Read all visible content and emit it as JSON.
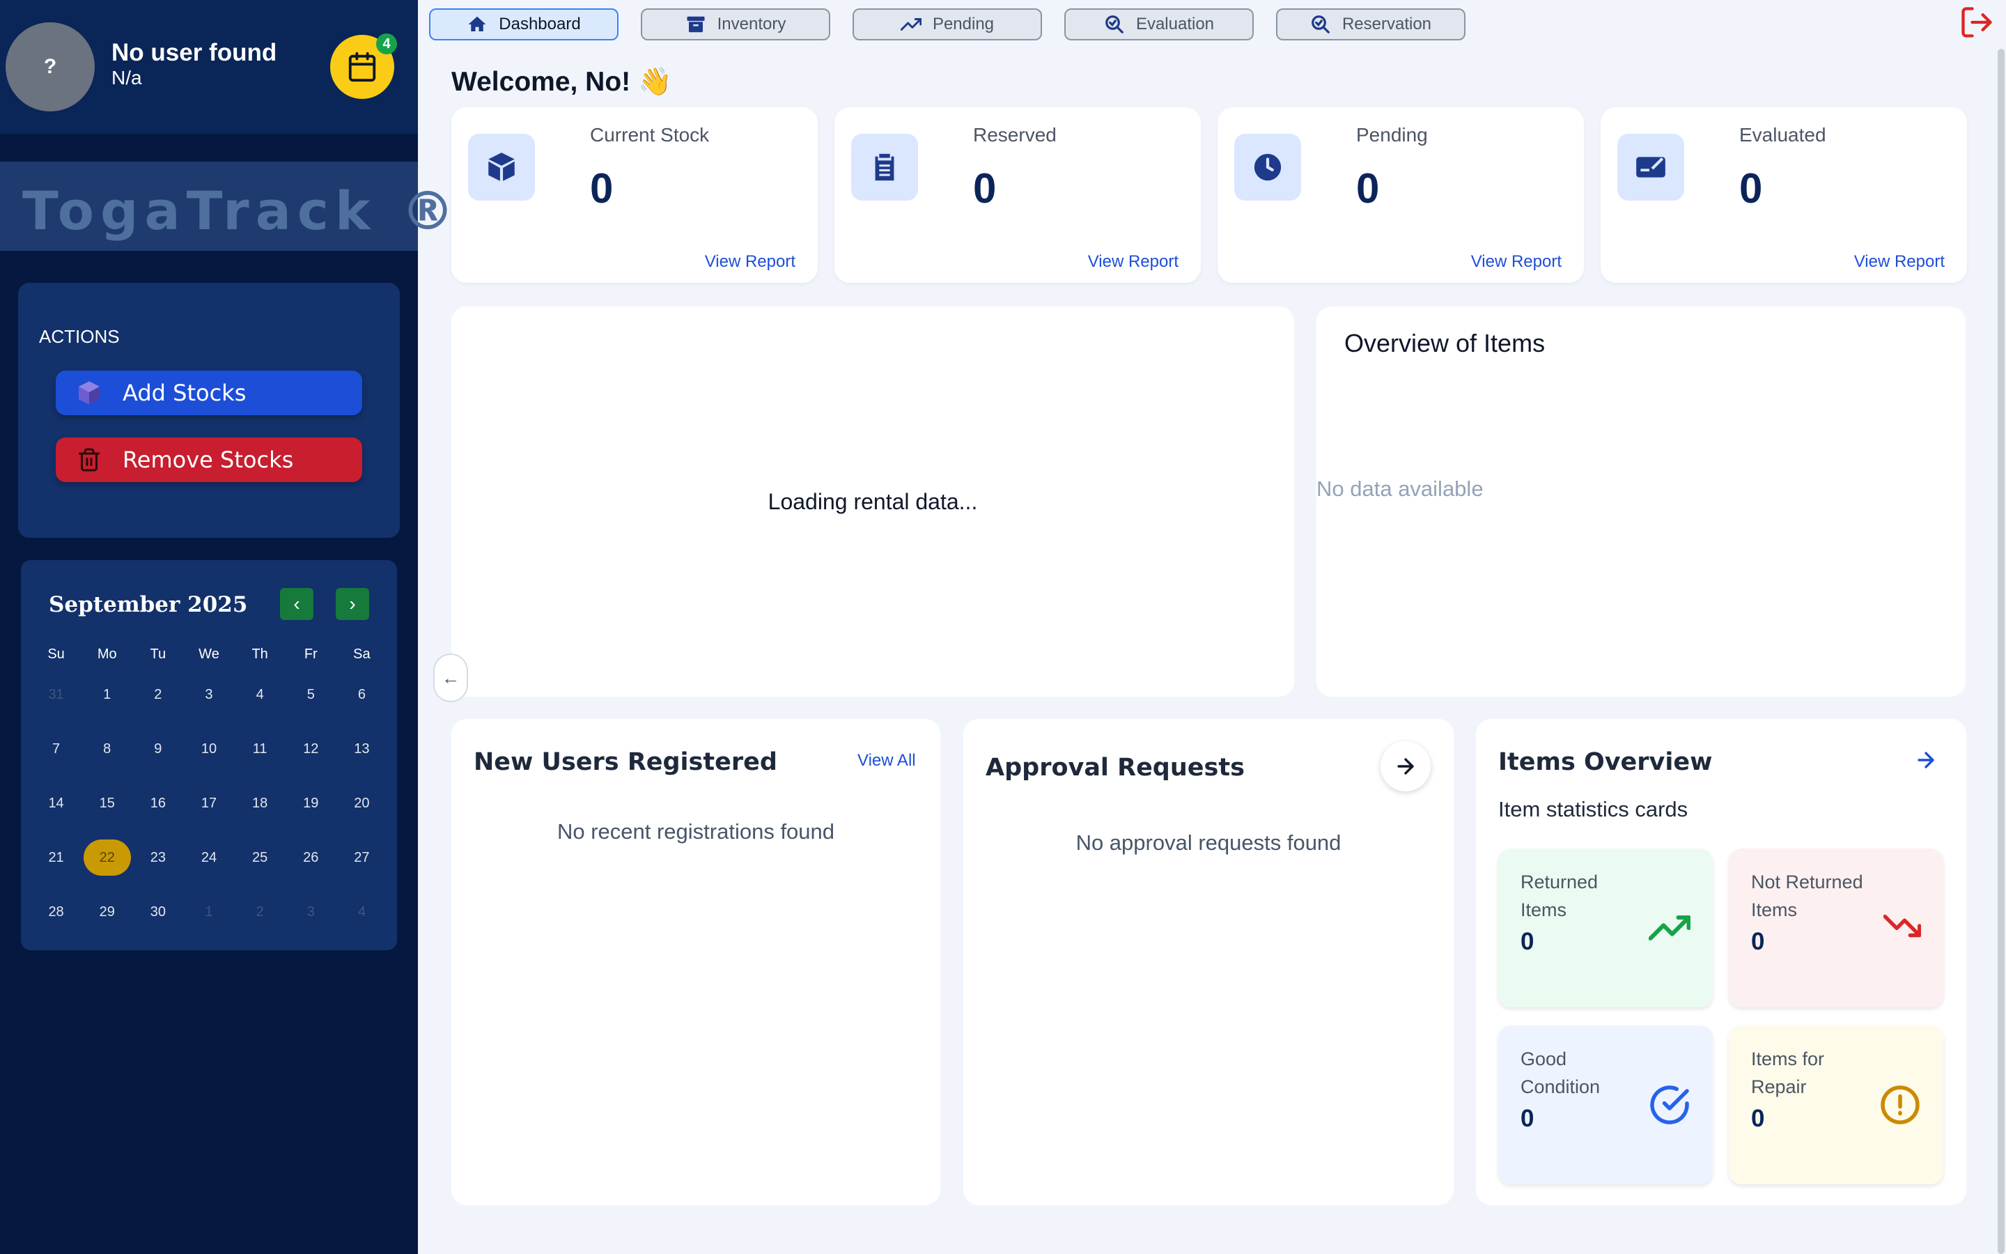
{
  "user": {
    "avatar_text": "?",
    "name": "No user found",
    "role": "N/a",
    "notification_count": "4"
  },
  "brand": "TogaTrack ®",
  "actions": {
    "title": "ACTIONS",
    "add_label": "Add Stocks",
    "remove_label": "Remove Stocks"
  },
  "calendar": {
    "month_label": "September 2025",
    "weekdays": [
      "Su",
      "Mo",
      "Tu",
      "We",
      "Th",
      "Fr",
      "Sa"
    ],
    "selected_day": "22",
    "weeks": [
      [
        {
          "d": "31",
          "m": true
        },
        {
          "d": "1"
        },
        {
          "d": "2"
        },
        {
          "d": "3"
        },
        {
          "d": "4"
        },
        {
          "d": "5"
        },
        {
          "d": "6"
        }
      ],
      [
        {
          "d": "7"
        },
        {
          "d": "8"
        },
        {
          "d": "9"
        },
        {
          "d": "10"
        },
        {
          "d": "11"
        },
        {
          "d": "12"
        },
        {
          "d": "13"
        }
      ],
      [
        {
          "d": "14"
        },
        {
          "d": "15"
        },
        {
          "d": "16"
        },
        {
          "d": "17"
        },
        {
          "d": "18"
        },
        {
          "d": "19"
        },
        {
          "d": "20"
        }
      ],
      [
        {
          "d": "21"
        },
        {
          "d": "22",
          "t": true
        },
        {
          "d": "23"
        },
        {
          "d": "24"
        },
        {
          "d": "25"
        },
        {
          "d": "26"
        },
        {
          "d": "27"
        }
      ],
      [
        {
          "d": "28"
        },
        {
          "d": "29"
        },
        {
          "d": "30"
        },
        {
          "d": "1",
          "m": true
        },
        {
          "d": "2",
          "m": true
        },
        {
          "d": "3",
          "m": true
        },
        {
          "d": "4",
          "m": true
        }
      ]
    ]
  },
  "tabs": [
    {
      "label": "Dashboard",
      "icon": "home-icon",
      "active": true
    },
    {
      "label": "Inventory",
      "icon": "archive-icon"
    },
    {
      "label": "Pending",
      "icon": "trending-up-icon"
    },
    {
      "label": "Evaluation",
      "icon": "search-check-icon"
    },
    {
      "label": "Reservation",
      "icon": "search-check-icon"
    }
  ],
  "welcome": "Welcome, No! 👋",
  "stats": [
    {
      "label": "Current Stock",
      "value": "0",
      "link": "View Report",
      "icon": "cube-icon"
    },
    {
      "label": "Reserved",
      "value": "0",
      "link": "View Report",
      "icon": "clipboard-icon"
    },
    {
      "label": "Pending",
      "value": "0",
      "link": "View Report",
      "icon": "clock-icon"
    },
    {
      "label": "Evaluated",
      "value": "0",
      "link": "View Report",
      "icon": "check-card-icon"
    }
  ],
  "rental": {
    "loading_text": "Loading rental data..."
  },
  "overview": {
    "title": "Overview of Items",
    "empty_text": "No data available"
  },
  "new_users": {
    "title": "New Users Registered",
    "link": "View All",
    "empty_text": "No recent registrations found"
  },
  "approvals": {
    "title": "Approval Requests",
    "empty_text": "No approval requests found"
  },
  "items_overview": {
    "title": "Items Overview",
    "subtitle": "Item statistics cards",
    "cards": [
      {
        "label": "Returned Items",
        "value": "0",
        "icon": "trending-up-icon",
        "bg": "#ecfbf1",
        "color": "#16a34a"
      },
      {
        "label": "Not Returned Items",
        "value": "0",
        "icon": "trending-down-icon",
        "bg": "#fdf0f0",
        "color": "#dc2626"
      },
      {
        "label": "Good Condition",
        "value": "0",
        "icon": "check-circle-icon",
        "bg": "#eef4ff",
        "color": "#2563eb"
      },
      {
        "label": "Items for Repair",
        "value": "0",
        "icon": "alert-circle-icon",
        "bg": "#fefbea",
        "color": "#ca8a04"
      }
    ]
  },
  "colors": {
    "sidebar": "#05183f",
    "accent": "#1d4ed8",
    "danger": "#c81e2f",
    "warning": "#facc15"
  }
}
